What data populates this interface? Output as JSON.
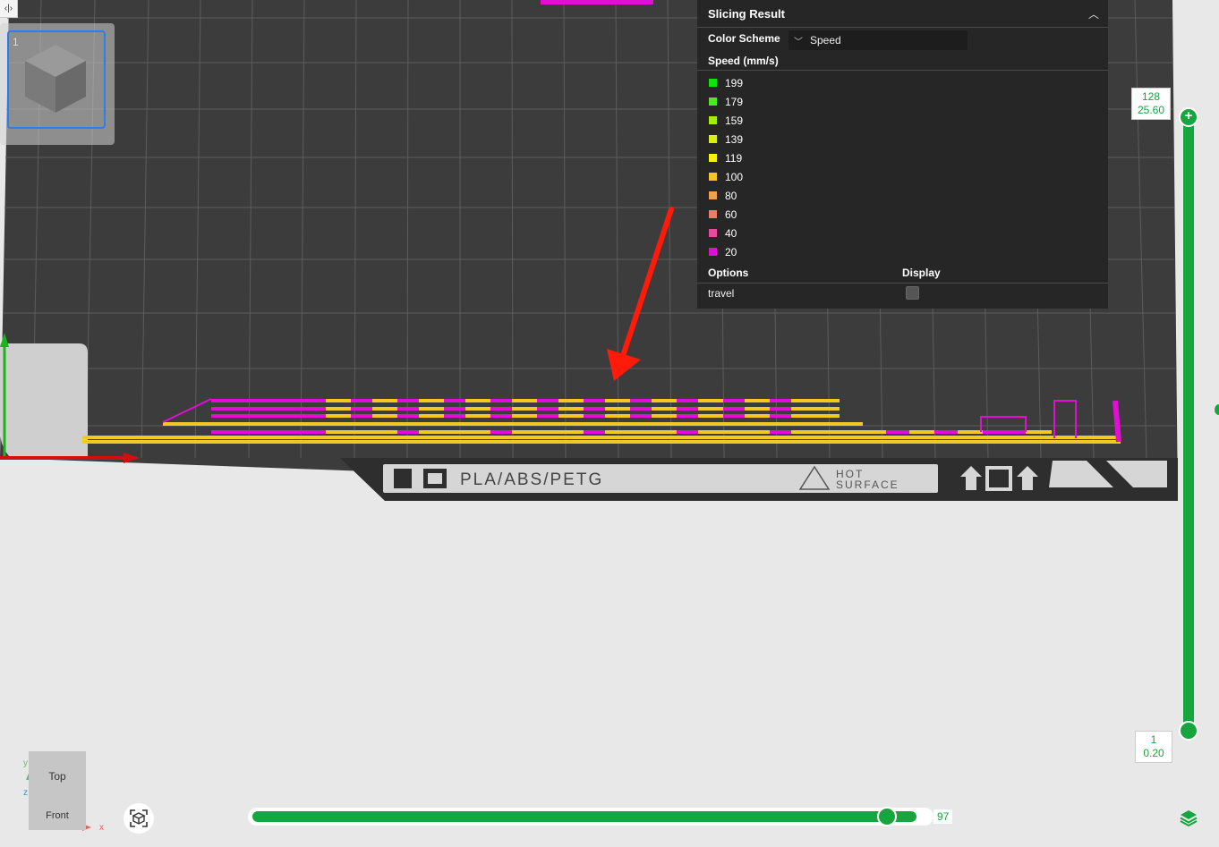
{
  "top_toggle": {
    "label": "‹|›"
  },
  "thumbnail": {
    "index": "1"
  },
  "slicing_result": {
    "title": "Slicing Result",
    "color_scheme_label": "Color Scheme",
    "color_scheme_value": "Speed",
    "speed_label": "Speed (mm/s)",
    "legend": [
      {
        "value": "199",
        "color": "#13e30d"
      },
      {
        "value": "179",
        "color": "#4fe914"
      },
      {
        "value": "159",
        "color": "#a6e91a"
      },
      {
        "value": "139",
        "color": "#d9ee12"
      },
      {
        "value": "119",
        "color": "#f4f20c"
      },
      {
        "value": "100",
        "color": "#f1c824"
      },
      {
        "value": "80",
        "color": "#f1a04b"
      },
      {
        "value": "60",
        "color": "#ef7a6a"
      },
      {
        "value": "40",
        "color": "#ea4a9d"
      },
      {
        "value": "20",
        "color": "#e10ed4"
      }
    ],
    "options_label": "Options",
    "display_label": "Display",
    "travel_label": "travel",
    "travel_checked": false
  },
  "layer_slider": {
    "top_layer": "128",
    "top_height": "25.60",
    "bottom_layer": "1",
    "bottom_height": "0.20"
  },
  "move_slider": {
    "value": "97",
    "fraction": 0.97
  },
  "bed": {
    "label": "PLA/ABS/PETG",
    "warning_line1": "HOT",
    "warning_line2": "SURFACE"
  },
  "view_cube": {
    "top": "Top",
    "front": "Front"
  },
  "axes": {
    "x": "x",
    "y": "y",
    "z": "z"
  },
  "colors": {
    "accent_green": "#16a53e",
    "plate": "#3c3c3c",
    "grid": "#5c5c5c",
    "panel": "#262626",
    "print_slow": "#e10ed4",
    "print_mid": "#f1c824",
    "arrow": "#ff1a0a"
  },
  "icons": {
    "collapse": "chevron-up-icon",
    "dropdown": "chevron-down-icon",
    "reset_view": "reset-view-icon",
    "layers": "layers-icon"
  }
}
